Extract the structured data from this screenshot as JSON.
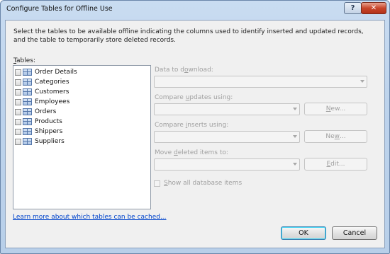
{
  "window": {
    "title": "Configure Tables for Offline Use",
    "help_glyph": "?",
    "close_glyph": "✕"
  },
  "description": "Select the tables to be available offline indicating the columns used to identify inserted and updated records, and the table to temporarily store deleted records.",
  "tables": {
    "label_accel": "T",
    "label_rest": "ables:",
    "items": [
      {
        "label": "Order Details",
        "checked": false
      },
      {
        "label": "Categories",
        "checked": false
      },
      {
        "label": "Customers",
        "checked": false
      },
      {
        "label": "Employees",
        "checked": false
      },
      {
        "label": "Orders",
        "checked": false
      },
      {
        "label": "Products",
        "checked": false
      },
      {
        "label": "Shippers",
        "checked": false
      },
      {
        "label": "Suppliers",
        "checked": false
      }
    ]
  },
  "download": {
    "label_pre": "Data to d",
    "label_accel": "o",
    "label_post": "wnload:",
    "value": ""
  },
  "updates": {
    "label_pre": "Compare ",
    "label_accel": "u",
    "label_post": "pdates using:",
    "value": "",
    "new_accel": "N",
    "new_rest": "ew..."
  },
  "inserts": {
    "label_pre": "Compare ",
    "label_accel": "i",
    "label_post": "nserts using:",
    "value": "",
    "new_pre": "Ne",
    "new_accel": "w",
    "new_post": "..."
  },
  "deleted": {
    "label_pre": "Move ",
    "label_accel": "d",
    "label_post": "eleted items to:",
    "value": "",
    "edit_accel": "E",
    "edit_rest": "dit..."
  },
  "show_all": {
    "accel": "S",
    "rest": "how all database items",
    "checked": false
  },
  "learn_more_link": "Learn more about which tables can be cached...",
  "buttons": {
    "ok": "OK",
    "cancel": "Cancel"
  },
  "colors": {
    "link": "#0044cc",
    "disabled_text": "#a0a0a0",
    "close_button": "#c8462b"
  }
}
